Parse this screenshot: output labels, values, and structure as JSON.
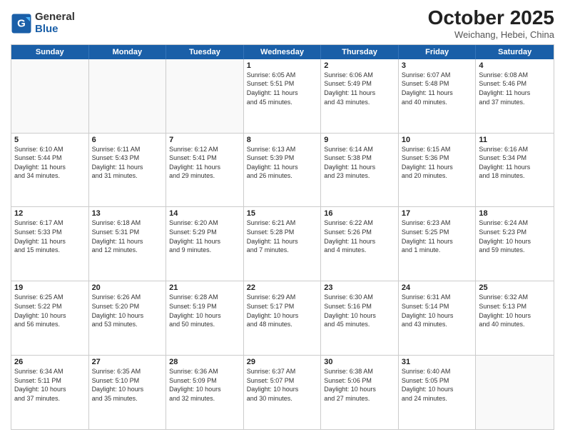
{
  "header": {
    "logo_general": "General",
    "logo_blue": "Blue",
    "month_title": "October 2025",
    "subtitle": "Weichang, Hebei, China"
  },
  "day_headers": [
    "Sunday",
    "Monday",
    "Tuesday",
    "Wednesday",
    "Thursday",
    "Friday",
    "Saturday"
  ],
  "weeks": [
    [
      {
        "num": "",
        "info": ""
      },
      {
        "num": "",
        "info": ""
      },
      {
        "num": "",
        "info": ""
      },
      {
        "num": "1",
        "info": "Sunrise: 6:05 AM\nSunset: 5:51 PM\nDaylight: 11 hours\nand 45 minutes."
      },
      {
        "num": "2",
        "info": "Sunrise: 6:06 AM\nSunset: 5:49 PM\nDaylight: 11 hours\nand 43 minutes."
      },
      {
        "num": "3",
        "info": "Sunrise: 6:07 AM\nSunset: 5:48 PM\nDaylight: 11 hours\nand 40 minutes."
      },
      {
        "num": "4",
        "info": "Sunrise: 6:08 AM\nSunset: 5:46 PM\nDaylight: 11 hours\nand 37 minutes."
      }
    ],
    [
      {
        "num": "5",
        "info": "Sunrise: 6:10 AM\nSunset: 5:44 PM\nDaylight: 11 hours\nand 34 minutes."
      },
      {
        "num": "6",
        "info": "Sunrise: 6:11 AM\nSunset: 5:43 PM\nDaylight: 11 hours\nand 31 minutes."
      },
      {
        "num": "7",
        "info": "Sunrise: 6:12 AM\nSunset: 5:41 PM\nDaylight: 11 hours\nand 29 minutes."
      },
      {
        "num": "8",
        "info": "Sunrise: 6:13 AM\nSunset: 5:39 PM\nDaylight: 11 hours\nand 26 minutes."
      },
      {
        "num": "9",
        "info": "Sunrise: 6:14 AM\nSunset: 5:38 PM\nDaylight: 11 hours\nand 23 minutes."
      },
      {
        "num": "10",
        "info": "Sunrise: 6:15 AM\nSunset: 5:36 PM\nDaylight: 11 hours\nand 20 minutes."
      },
      {
        "num": "11",
        "info": "Sunrise: 6:16 AM\nSunset: 5:34 PM\nDaylight: 11 hours\nand 18 minutes."
      }
    ],
    [
      {
        "num": "12",
        "info": "Sunrise: 6:17 AM\nSunset: 5:33 PM\nDaylight: 11 hours\nand 15 minutes."
      },
      {
        "num": "13",
        "info": "Sunrise: 6:18 AM\nSunset: 5:31 PM\nDaylight: 11 hours\nand 12 minutes."
      },
      {
        "num": "14",
        "info": "Sunrise: 6:20 AM\nSunset: 5:29 PM\nDaylight: 11 hours\nand 9 minutes."
      },
      {
        "num": "15",
        "info": "Sunrise: 6:21 AM\nSunset: 5:28 PM\nDaylight: 11 hours\nand 7 minutes."
      },
      {
        "num": "16",
        "info": "Sunrise: 6:22 AM\nSunset: 5:26 PM\nDaylight: 11 hours\nand 4 minutes."
      },
      {
        "num": "17",
        "info": "Sunrise: 6:23 AM\nSunset: 5:25 PM\nDaylight: 11 hours\nand 1 minute."
      },
      {
        "num": "18",
        "info": "Sunrise: 6:24 AM\nSunset: 5:23 PM\nDaylight: 10 hours\nand 59 minutes."
      }
    ],
    [
      {
        "num": "19",
        "info": "Sunrise: 6:25 AM\nSunset: 5:22 PM\nDaylight: 10 hours\nand 56 minutes."
      },
      {
        "num": "20",
        "info": "Sunrise: 6:26 AM\nSunset: 5:20 PM\nDaylight: 10 hours\nand 53 minutes."
      },
      {
        "num": "21",
        "info": "Sunrise: 6:28 AM\nSunset: 5:19 PM\nDaylight: 10 hours\nand 50 minutes."
      },
      {
        "num": "22",
        "info": "Sunrise: 6:29 AM\nSunset: 5:17 PM\nDaylight: 10 hours\nand 48 minutes."
      },
      {
        "num": "23",
        "info": "Sunrise: 6:30 AM\nSunset: 5:16 PM\nDaylight: 10 hours\nand 45 minutes."
      },
      {
        "num": "24",
        "info": "Sunrise: 6:31 AM\nSunset: 5:14 PM\nDaylight: 10 hours\nand 43 minutes."
      },
      {
        "num": "25",
        "info": "Sunrise: 6:32 AM\nSunset: 5:13 PM\nDaylight: 10 hours\nand 40 minutes."
      }
    ],
    [
      {
        "num": "26",
        "info": "Sunrise: 6:34 AM\nSunset: 5:11 PM\nDaylight: 10 hours\nand 37 minutes."
      },
      {
        "num": "27",
        "info": "Sunrise: 6:35 AM\nSunset: 5:10 PM\nDaylight: 10 hours\nand 35 minutes."
      },
      {
        "num": "28",
        "info": "Sunrise: 6:36 AM\nSunset: 5:09 PM\nDaylight: 10 hours\nand 32 minutes."
      },
      {
        "num": "29",
        "info": "Sunrise: 6:37 AM\nSunset: 5:07 PM\nDaylight: 10 hours\nand 30 minutes."
      },
      {
        "num": "30",
        "info": "Sunrise: 6:38 AM\nSunset: 5:06 PM\nDaylight: 10 hours\nand 27 minutes."
      },
      {
        "num": "31",
        "info": "Sunrise: 6:40 AM\nSunset: 5:05 PM\nDaylight: 10 hours\nand 24 minutes."
      },
      {
        "num": "",
        "info": ""
      }
    ]
  ]
}
